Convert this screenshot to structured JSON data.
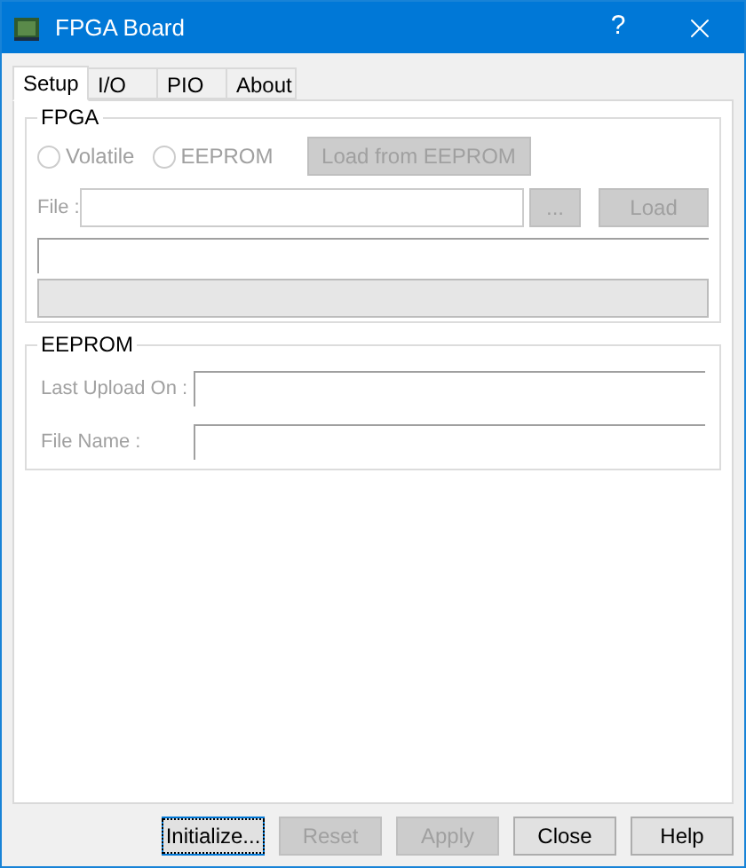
{
  "window": {
    "title": "FPGA Board",
    "help": "?"
  },
  "tabs": [
    {
      "label": "Setup",
      "selected": true
    },
    {
      "label": "I/O",
      "selected": false
    },
    {
      "label": "PIO",
      "selected": false
    },
    {
      "label": "About",
      "selected": false
    }
  ],
  "fpga": {
    "title": "FPGA",
    "radios": [
      {
        "label": "Volatile",
        "selected": false,
        "disabled": true
      },
      {
        "label": "EEPROM",
        "selected": false,
        "disabled": true
      }
    ],
    "load_from_eeprom": {
      "label": "Load from EEPROM",
      "disabled": true
    },
    "file_label": "File :",
    "browse": {
      "label": "...",
      "disabled": true
    },
    "load": {
      "label": "Load",
      "disabled": true
    }
  },
  "eeprom": {
    "title": "EEPROM",
    "fields": [
      {
        "label": "Last Upload On :"
      },
      {
        "label": "File Name :"
      }
    ]
  },
  "buttons": [
    {
      "label": "Initialize...",
      "disabled": false,
      "focused": true
    },
    {
      "label": "Reset",
      "disabled": true,
      "focused": false
    },
    {
      "label": "Apply",
      "disabled": true,
      "focused": false
    },
    {
      "label": "Close",
      "disabled": false,
      "focused": false
    },
    {
      "label": "Help",
      "disabled": false,
      "focused": false
    }
  ]
}
